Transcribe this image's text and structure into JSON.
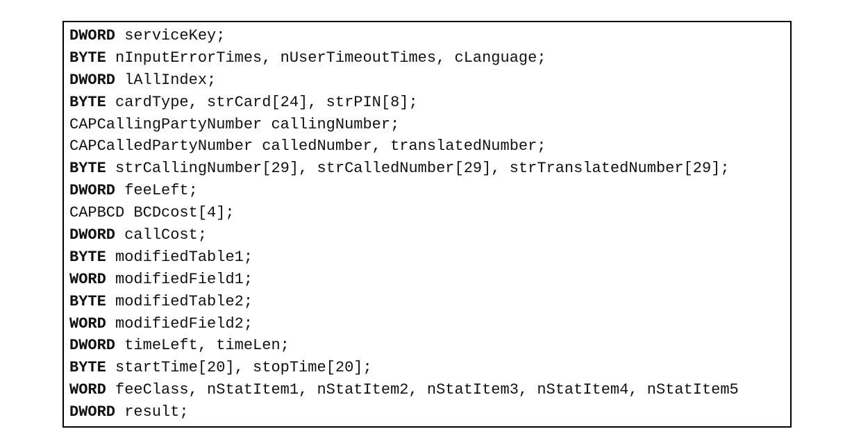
{
  "lines": [
    {
      "keyword": "DWORD",
      "rest": " serviceKey;"
    },
    {
      "keyword": "BYTE",
      "rest": " nInputErrorTimes, nUserTimeoutTimes, cLanguage;"
    },
    {
      "keyword": "DWORD",
      "rest": " lAllIndex;"
    },
    {
      "keyword": "BYTE",
      "rest": " cardType, strCard[24], strPIN[8];"
    },
    {
      "keyword": "",
      "rest": "CAPCallingPartyNumber callingNumber;"
    },
    {
      "keyword": "",
      "rest": "CAPCalledPartyNumber calledNumber, translatedNumber;"
    },
    {
      "keyword": "BYTE",
      "rest": " strCallingNumber[29], strCalledNumber[29], strTranslatedNumber[29];"
    },
    {
      "keyword": "DWORD",
      "rest": " feeLeft;"
    },
    {
      "keyword": "",
      "rest": "CAPBCD BCDcost[4];"
    },
    {
      "keyword": "DWORD",
      "rest": " callCost;"
    },
    {
      "keyword": "BYTE",
      "rest": " modifiedTable1;"
    },
    {
      "keyword": "WORD",
      "rest": " modifiedField1;"
    },
    {
      "keyword": "BYTE",
      "rest": " modifiedTable2;"
    },
    {
      "keyword": "WORD",
      "rest": " modifiedField2;"
    },
    {
      "keyword": "DWORD",
      "rest": " timeLeft, timeLen;"
    },
    {
      "keyword": "BYTE",
      "rest": " startTime[20], stopTime[20];"
    },
    {
      "keyword": "WORD",
      "rest": " feeClass, nStatItem1, nStatItem2, nStatItem3, nStatItem4, nStatItem5"
    },
    {
      "keyword": "DWORD",
      "rest": " result;"
    }
  ]
}
